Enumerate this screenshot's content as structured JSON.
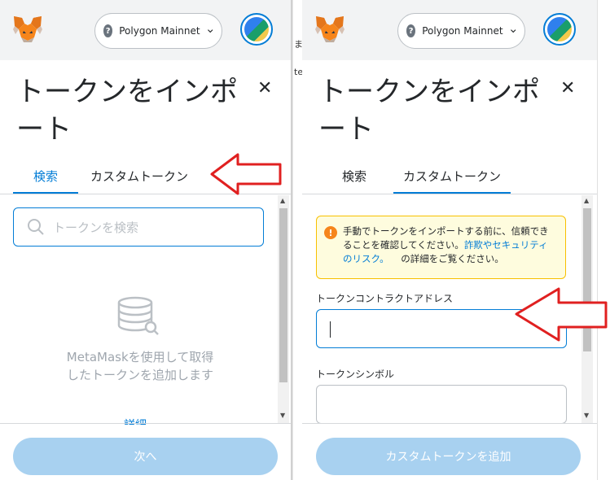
{
  "left_panel": {
    "network": "Polygon Mainnet",
    "title": "トークンをインポート",
    "tabs": [
      "検索",
      "カスタムトークン"
    ],
    "search_placeholder": "トークンを検索",
    "empty_message": "MetaMaskを使用して取得したトークンを追加します",
    "detail_link": "詳細",
    "next_button": "次へ"
  },
  "right_panel": {
    "network": "Polygon Mainnet",
    "title": "トークンをインポート",
    "tabs": [
      "検索",
      "カスタムトークン"
    ],
    "warning": {
      "text_before": "手動でトークンをインポートする前に、信頼できることを確認してください。",
      "link": "詐欺やセキュリティのリスク。",
      "text_after": "の詳細をご覧ください。"
    },
    "address_label": "トークンコントラクトアドレス",
    "address_value": "",
    "symbol_label": "トークンシンボル",
    "symbol_value": "",
    "add_button": "カスタムトークンを追加"
  },
  "background_window_fragments": [
    "ま",
    "te"
  ],
  "colors": {
    "accent": "#037dd6",
    "annotation_arrow": "#e02020",
    "warning_border": "#f8c000",
    "button_disabled": "#a8d1f0"
  },
  "icons": [
    "metamask-fox-icon",
    "question-icon",
    "chevron-down-icon",
    "search-icon",
    "database-icon",
    "warning-icon",
    "close-icon",
    "red-arrow-icon"
  ]
}
